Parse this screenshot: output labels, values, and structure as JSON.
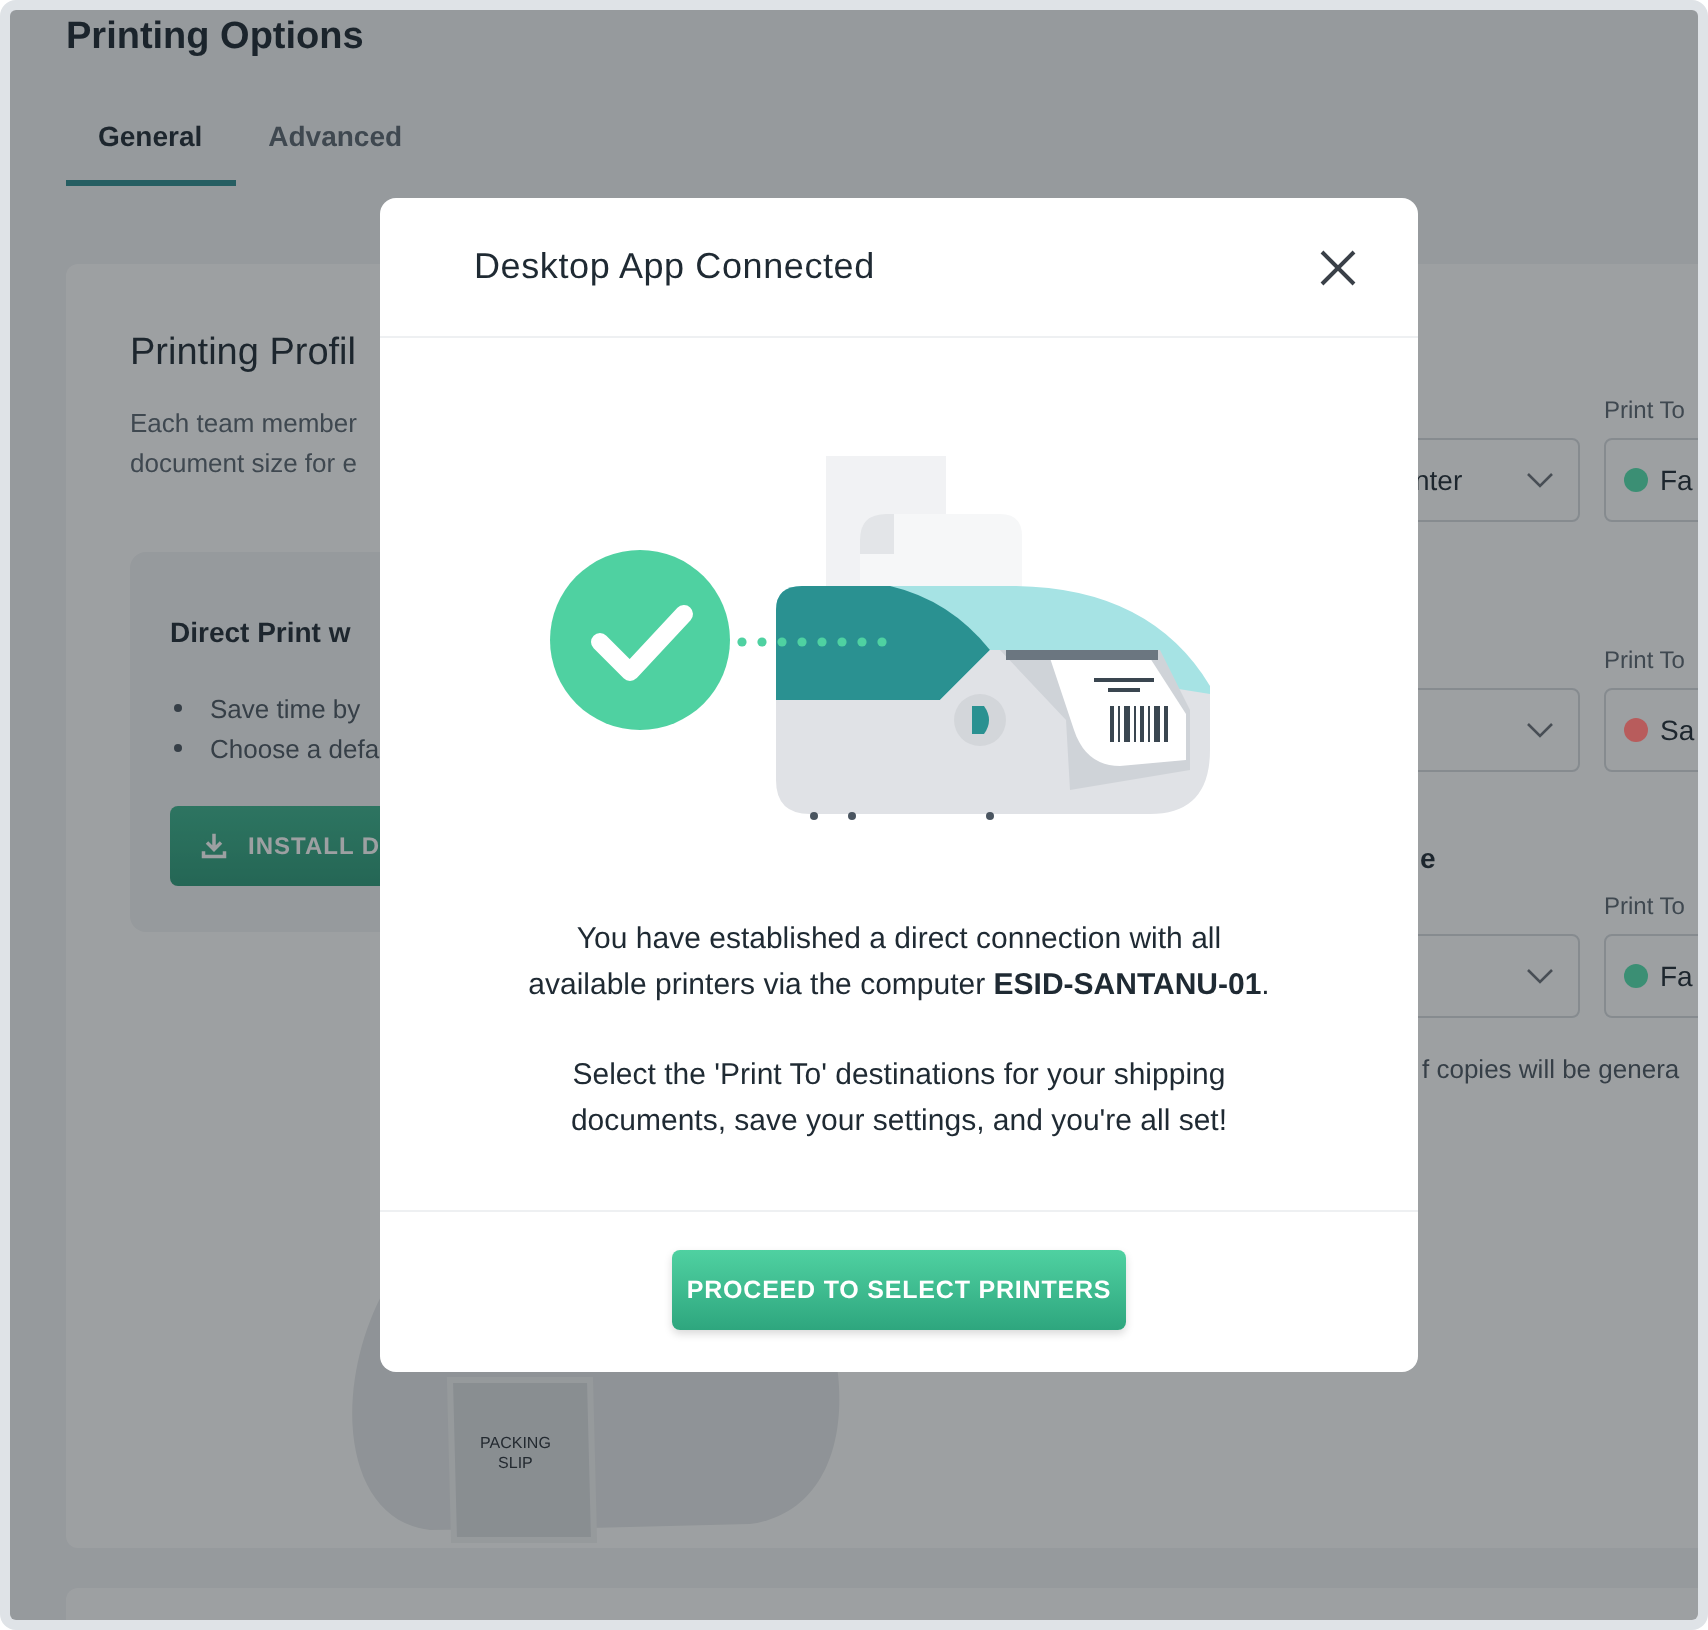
{
  "page": {
    "title": "Printing Options",
    "tabs": [
      {
        "label": "General",
        "selected": true
      },
      {
        "label": "Advanced",
        "selected": false
      }
    ]
  },
  "profile_card": {
    "title": "Printing Profil",
    "description": [
      "Each team member",
      "document size for e"
    ],
    "direct_print": {
      "title": "Direct Print w",
      "bullets": [
        "Save time by",
        "Choose a defa"
      ],
      "install_button": "INSTALL D"
    },
    "rows": [
      {
        "label": "Print To",
        "select_value": "nter",
        "destination": {
          "text": "Fa",
          "color": "#3b8f74"
        }
      },
      {
        "label": "Print To",
        "destination": {
          "text": "Sa",
          "color": "#b85c5c"
        }
      },
      {
        "section_heading": "e",
        "label": "Print To",
        "destination": {
          "text": "Fa",
          "color": "#3b8f74"
        },
        "note": "f copies will be genera"
      }
    ],
    "packing_slip_lines": [
      "PACKING",
      "SLIP"
    ]
  },
  "modal": {
    "title": "Desktop App Connected",
    "paragraphs": [
      "You have established a direct connection with all available printers via the computer **ESID-SANTANU-01**.",
      "Select the 'Print To' destinations for your shipping documents, save your settings, and you're all set!"
    ],
    "button": "PROCEED TO SELECT PRINTERS"
  }
}
